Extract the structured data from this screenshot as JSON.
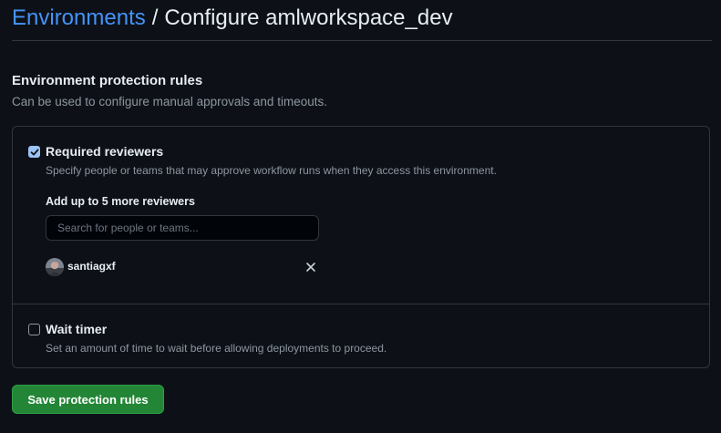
{
  "breadcrumb": {
    "parent_label": "Environments",
    "separator": "/",
    "current_label": "Configure amlworkspace_dev"
  },
  "protection_rules": {
    "title": "Environment protection rules",
    "description": "Can be used to configure manual approvals and timeouts."
  },
  "required_reviewers": {
    "label": "Required reviewers",
    "checked": true,
    "description": "Specify people or teams that may approve workflow runs when they access this environment.",
    "add_label": "Add up to 5 more reviewers",
    "search_placeholder": "Search for people or teams...",
    "search_value": "",
    "reviewers": [
      {
        "username": "santiagxf",
        "avatar_icon": "user-avatar",
        "remove_icon": "close-icon"
      }
    ]
  },
  "wait_timer": {
    "label": "Wait timer",
    "checked": false,
    "description": "Set an amount of time to wait before allowing deployments to proceed."
  },
  "actions": {
    "save_label": "Save protection rules"
  },
  "colors": {
    "background": "#0d1117",
    "link": "#4493f8",
    "border": "#30363d",
    "muted_text": "#8d96a0",
    "primary_button": "#238636",
    "checkbox_checked": "#9cc3f5"
  }
}
